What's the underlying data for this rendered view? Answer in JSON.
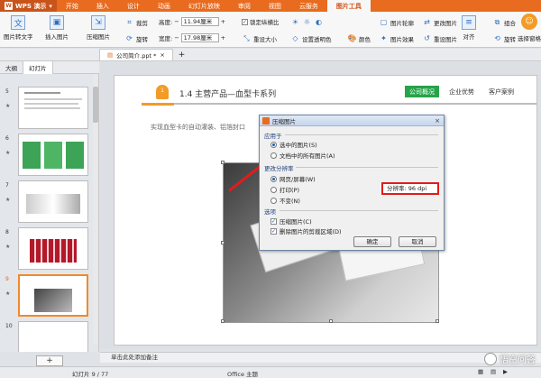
{
  "title_bar": {
    "app_name": "WPS 演示",
    "tabs": [
      "开始",
      "插入",
      "设计",
      "动画",
      "幻灯片放映",
      "审阅",
      "视图",
      "云服务",
      "图片工具"
    ],
    "active_tab": "图片工具"
  },
  "ribbon": {
    "pic_to_text": "图片转文字",
    "insert_pic": "插入图片",
    "compress_pic": "压缩图片",
    "crop": "裁剪",
    "rotate": "旋转",
    "height_label": "高度:",
    "height_value": "11.94厘米",
    "width_label": "宽度:",
    "width_value": "17.98厘米",
    "lock_ratio": "锁定纵横比",
    "reset_size": "重设大小",
    "set_transparent": "设置透明色",
    "color": "颜色",
    "pic_outline": "图片轮廓",
    "pic_effect": "图片效果",
    "change_pic": "更改图片",
    "reset_pic": "重设图片",
    "align": "对齐",
    "group": "组合",
    "rotate2": "旋转",
    "selection_pane": "选择窗格"
  },
  "doc_tab": {
    "filename": "公司简介.ppt *"
  },
  "panel_tabs": [
    "大纲",
    "幻灯片"
  ],
  "thumbnails": {
    "numbers": [
      "5",
      "6",
      "7",
      "8",
      "9",
      "10"
    ],
    "selected": "9"
  },
  "slide": {
    "marker": "1",
    "title": "1.4  主营产品—血型卡系列",
    "nav": [
      "公司概况",
      "企业优势",
      "客户案例"
    ],
    "body_text": "实现血型卡的自动灌装、铝箔封口"
  },
  "dialog": {
    "title": "压缩图片",
    "apply_section": "应用于",
    "apply_opts": [
      "选中的图片(S)",
      "文档中的所有图片(A)"
    ],
    "resolution_section": "更改分辨率",
    "res_opts": [
      "网页/屏幕(W)",
      "打印(P)",
      "不变(N)"
    ],
    "resolution_readout": "分辨率: 96 dpi",
    "options_section": "选项",
    "option_checks": [
      "压缩图片(C)",
      "删除图片的剪裁区域(D)"
    ],
    "ok": "确定",
    "cancel": "取消"
  },
  "notes_placeholder": "单击此处添加备注",
  "status": {
    "slide_counter": "幻灯片 9 / 77",
    "theme": "Office 主题"
  },
  "watermark": "悟空问答",
  "colors": {
    "wps_orange": "#e86b1f",
    "accent_green": "#27a34a",
    "annotation_red": "#e11c1c"
  }
}
